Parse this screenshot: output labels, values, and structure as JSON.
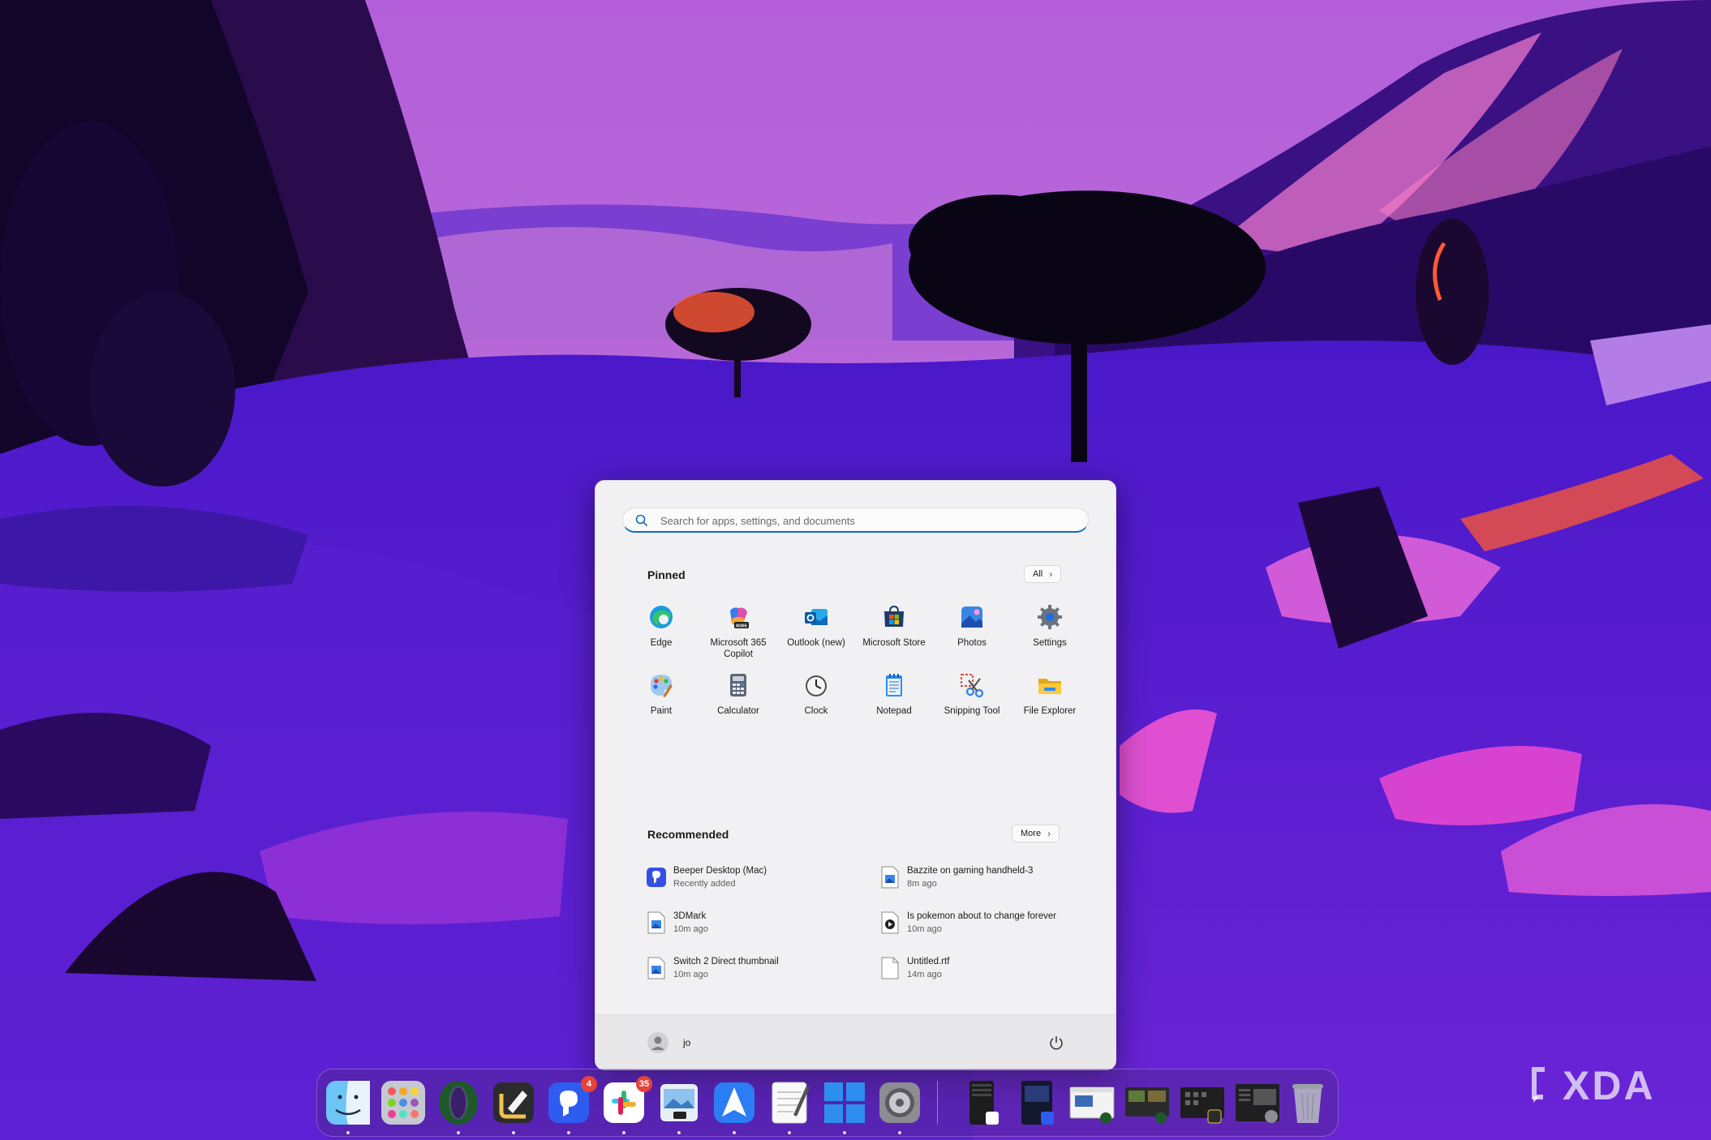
{
  "search": {
    "placeholder": "Search for apps, settings, and documents"
  },
  "pinned": {
    "title": "Pinned",
    "all_label": "All",
    "apps": [
      {
        "label": "Edge",
        "icon": "edge-icon"
      },
      {
        "label": "Microsoft 365 Copilot",
        "icon": "copilot-icon"
      },
      {
        "label": "Outlook (new)",
        "icon": "outlook-icon"
      },
      {
        "label": "Microsoft Store",
        "icon": "store-icon"
      },
      {
        "label": "Photos",
        "icon": "photos-icon"
      },
      {
        "label": "Settings",
        "icon": "gear-icon"
      },
      {
        "label": "Paint",
        "icon": "paint-icon"
      },
      {
        "label": "Calculator",
        "icon": "calculator-icon"
      },
      {
        "label": "Clock",
        "icon": "clock-icon"
      },
      {
        "label": "Notepad",
        "icon": "notepad-icon"
      },
      {
        "label": "Snipping Tool",
        "icon": "snipping-icon"
      },
      {
        "label": "File Explorer",
        "icon": "folder-icon"
      }
    ]
  },
  "recommended": {
    "title": "Recommended",
    "more_label": "More",
    "items": [
      {
        "name": "Beeper Desktop (Mac)",
        "sub": "Recently added",
        "icon": "beeper-icon"
      },
      {
        "name": "Bazzite on gaming handheld-3",
        "sub": "8m ago",
        "icon": "image-file-icon"
      },
      {
        "name": "3DMark",
        "sub": "10m ago",
        "icon": "image-file-icon"
      },
      {
        "name": "Is pokemon about to change forever",
        "sub": "10m ago",
        "icon": "video-file-icon"
      },
      {
        "name": "Switch 2 Direct thumbnail",
        "sub": "10m ago",
        "icon": "image-file-icon"
      },
      {
        "name": "Untitled.rtf",
        "sub": "14m ago",
        "icon": "document-file-icon"
      }
    ]
  },
  "user": {
    "name": "jo"
  },
  "dock": {
    "badges": {
      "beeper": "4",
      "slack": "35"
    }
  },
  "watermark": {
    "text": "XDA"
  },
  "colors": {
    "accent": "#0f6cbd",
    "badge": "#e5423a",
    "menu_bg": "#f1f1f3"
  }
}
